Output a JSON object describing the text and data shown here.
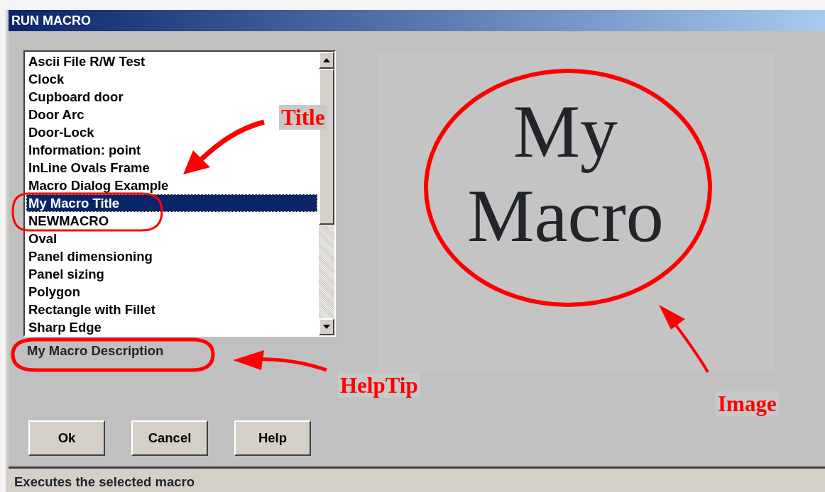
{
  "window": {
    "title": "RUN MACRO"
  },
  "macro_list": {
    "items": [
      {
        "label": "Ascii File R/W Test",
        "selected": false
      },
      {
        "label": "Clock",
        "selected": false
      },
      {
        "label": "Cupboard door",
        "selected": false
      },
      {
        "label": "Door Arc",
        "selected": false
      },
      {
        "label": "Door-Lock",
        "selected": false
      },
      {
        "label": "Information: point",
        "selected": false
      },
      {
        "label": "InLine Ovals Frame",
        "selected": false
      },
      {
        "label": "Macro Dialog Example",
        "selected": false
      },
      {
        "label": "My Macro Title",
        "selected": true
      },
      {
        "label": "NEWMACRO",
        "selected": false
      },
      {
        "label": "Oval",
        "selected": false
      },
      {
        "label": "Panel dimensioning",
        "selected": false
      },
      {
        "label": "Panel sizing",
        "selected": false
      },
      {
        "label": "Polygon",
        "selected": false
      },
      {
        "label": "Rectangle with Fillet",
        "selected": false
      },
      {
        "label": "Sharp Edge",
        "selected": false
      }
    ]
  },
  "description": "My Macro Description",
  "preview": {
    "lines": [
      "My",
      "Macro"
    ]
  },
  "buttons": [
    {
      "label": "Ok"
    },
    {
      "label": "Cancel"
    },
    {
      "label": "Help"
    }
  ],
  "status_bar": "Executes the selected macro",
  "annotations": [
    {
      "kind": "title",
      "text": "Title"
    },
    {
      "kind": "helptip",
      "text": "HelpTip"
    },
    {
      "kind": "image",
      "text": "Image"
    }
  ]
}
